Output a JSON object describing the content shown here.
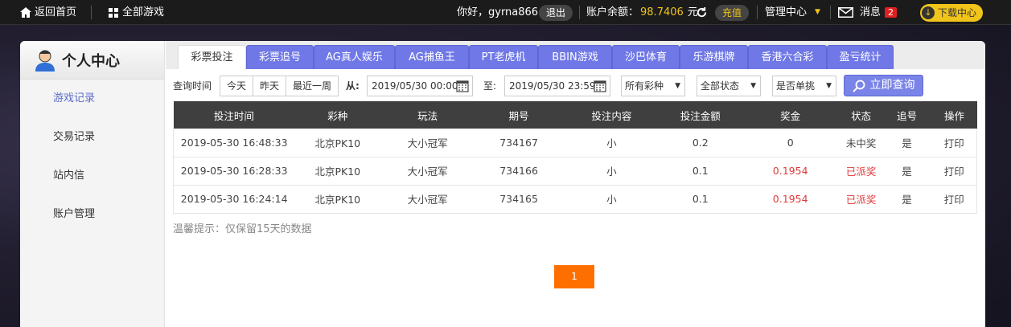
{
  "topbar": {
    "home_label": "返回首页",
    "all_games_label": "全部游戏",
    "greeting": "你好，gyrna866",
    "logout_label": "退出",
    "balance_label": "账户余额：",
    "balance_value": "98.7406",
    "balance_unit": "元",
    "recharge_label": "充值",
    "manage_label": "管理中心",
    "message_label": "消息",
    "message_count": "2",
    "download_label": "下载中心"
  },
  "sidebar": {
    "title": "个人中心",
    "items": [
      {
        "label": "游戏记录"
      },
      {
        "label": "交易记录"
      },
      {
        "label": "站内信"
      },
      {
        "label": "账户管理"
      }
    ]
  },
  "tabs": [
    {
      "label": "彩票投注"
    },
    {
      "label": "彩票追号"
    },
    {
      "label": "AG真人娱乐"
    },
    {
      "label": "AG捕鱼王"
    },
    {
      "label": "PT老虎机"
    },
    {
      "label": "BBIN游戏"
    },
    {
      "label": "沙巴体育"
    },
    {
      "label": "乐游棋牌"
    },
    {
      "label": "香港六合彩"
    },
    {
      "label": "盈亏统计"
    }
  ],
  "filters": {
    "query_time_label": "查询时间",
    "today": "今天",
    "yesterday": "昨天",
    "last_week": "最近一周",
    "from_label": "从:",
    "from_value": "2019/05/30 00:00",
    "to_label": "至:",
    "to_value": "2019/05/30 23:59",
    "lottery_select": "所有彩种",
    "status_select": "全部状态",
    "single_select": "是否单挑",
    "query_button": "立即查询"
  },
  "table": {
    "headers": [
      "投注时间",
      "彩种",
      "玩法",
      "期号",
      "投注内容",
      "投注金额",
      "奖金",
      "状态",
      "追号",
      "操作"
    ],
    "rows": [
      {
        "time": "2019-05-30 16:48:33",
        "lottery": "北京PK10",
        "play": "大小冠军",
        "issue": "734167",
        "content": "小",
        "amount": "0.2",
        "bonus": "0",
        "status": "未中奖",
        "chase": "是",
        "action": "打印"
      },
      {
        "time": "2019-05-30 16:28:33",
        "lottery": "北京PK10",
        "play": "大小冠军",
        "issue": "734166",
        "content": "小",
        "amount": "0.1",
        "bonus": "0.1954",
        "status": "已派奖",
        "chase": "是",
        "action": "打印"
      },
      {
        "time": "2019-05-30 16:24:14",
        "lottery": "北京PK10",
        "play": "大小冠军",
        "issue": "734165",
        "content": "小",
        "amount": "0.1",
        "bonus": "0.1954",
        "status": "已派奖",
        "chase": "是",
        "action": "打印"
      }
    ]
  },
  "tip": "温馨提示：仅保留15天的数据",
  "pagination": {
    "current": "1"
  },
  "colors": {
    "accent": "#6f78e6",
    "highlight": "#e03b3b",
    "page": "#ff6f00",
    "gold": "#f0c419"
  }
}
